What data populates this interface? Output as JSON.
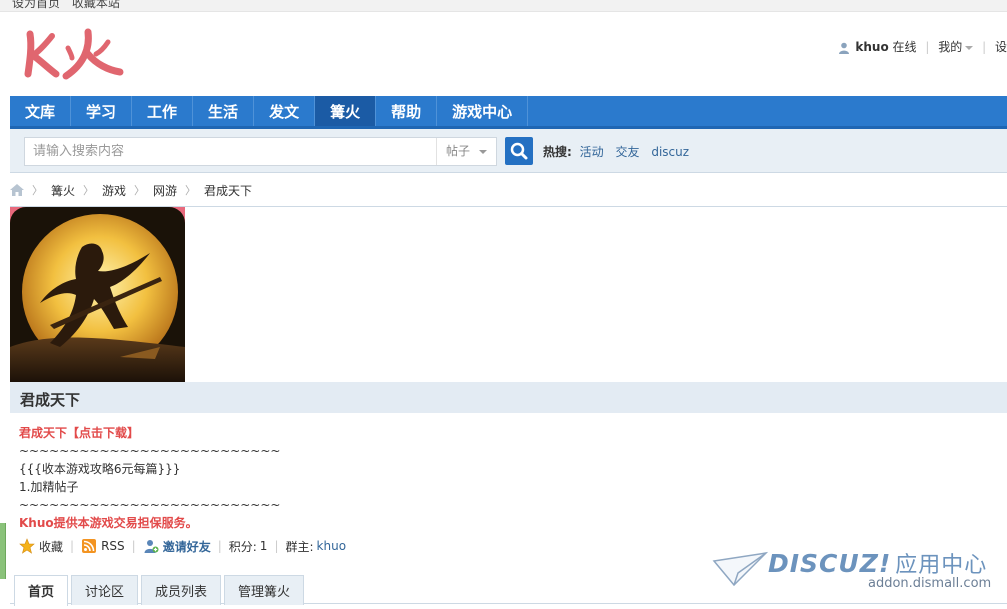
{
  "topbar": {
    "links": [
      "设为首页",
      "收藏本站"
    ]
  },
  "header": {
    "logo_text": "K火",
    "user": {
      "name": "khuo",
      "status": "在线",
      "menu_label": "我的",
      "settings_label": "设"
    }
  },
  "nav": {
    "items": [
      {
        "label": "文库"
      },
      {
        "label": "学习"
      },
      {
        "label": "工作"
      },
      {
        "label": "生活"
      },
      {
        "label": "发文"
      },
      {
        "label": "篝火",
        "active": true
      },
      {
        "label": "帮助"
      },
      {
        "label": "游戏中心"
      }
    ],
    "color": "#2b7acd"
  },
  "search": {
    "placeholder": "请输入搜索内容",
    "type_selected": "帖子",
    "hot_label": "热搜:",
    "hot_terms": [
      "活动",
      "交友",
      "discuz"
    ]
  },
  "breadcrumb": {
    "items": [
      "篝火",
      "游戏",
      "网游",
      "君成天下"
    ]
  },
  "group": {
    "name": "君成天下",
    "description": {
      "line1": "君成天下【点击下载】",
      "line2": "~~~~~~~~~~~~~~~~~~~~~~~~~~",
      "line3": "{{{收本游戏攻略6元每篇}}}",
      "line4": "1.加精帖子",
      "line5": "~~~~~~~~~~~~~~~~~~~~~~~~~~",
      "line6": "Khuo提供本游戏交易担保服务。"
    },
    "actions": {
      "favorite": "收藏",
      "rss": "RSS",
      "invite": "邀请好友",
      "points_label": "积分:",
      "points_value": "1",
      "owner_label": "群主:",
      "owner_name": "khuo"
    }
  },
  "tabs": [
    {
      "label": "首页",
      "active": true
    },
    {
      "label": "讨论区"
    },
    {
      "label": "成员列表"
    },
    {
      "label": "管理篝火"
    }
  ],
  "watermark": {
    "brand": "DISCUZ!",
    "subtitle": "应用中心",
    "url": "addon.dismall.com"
  }
}
